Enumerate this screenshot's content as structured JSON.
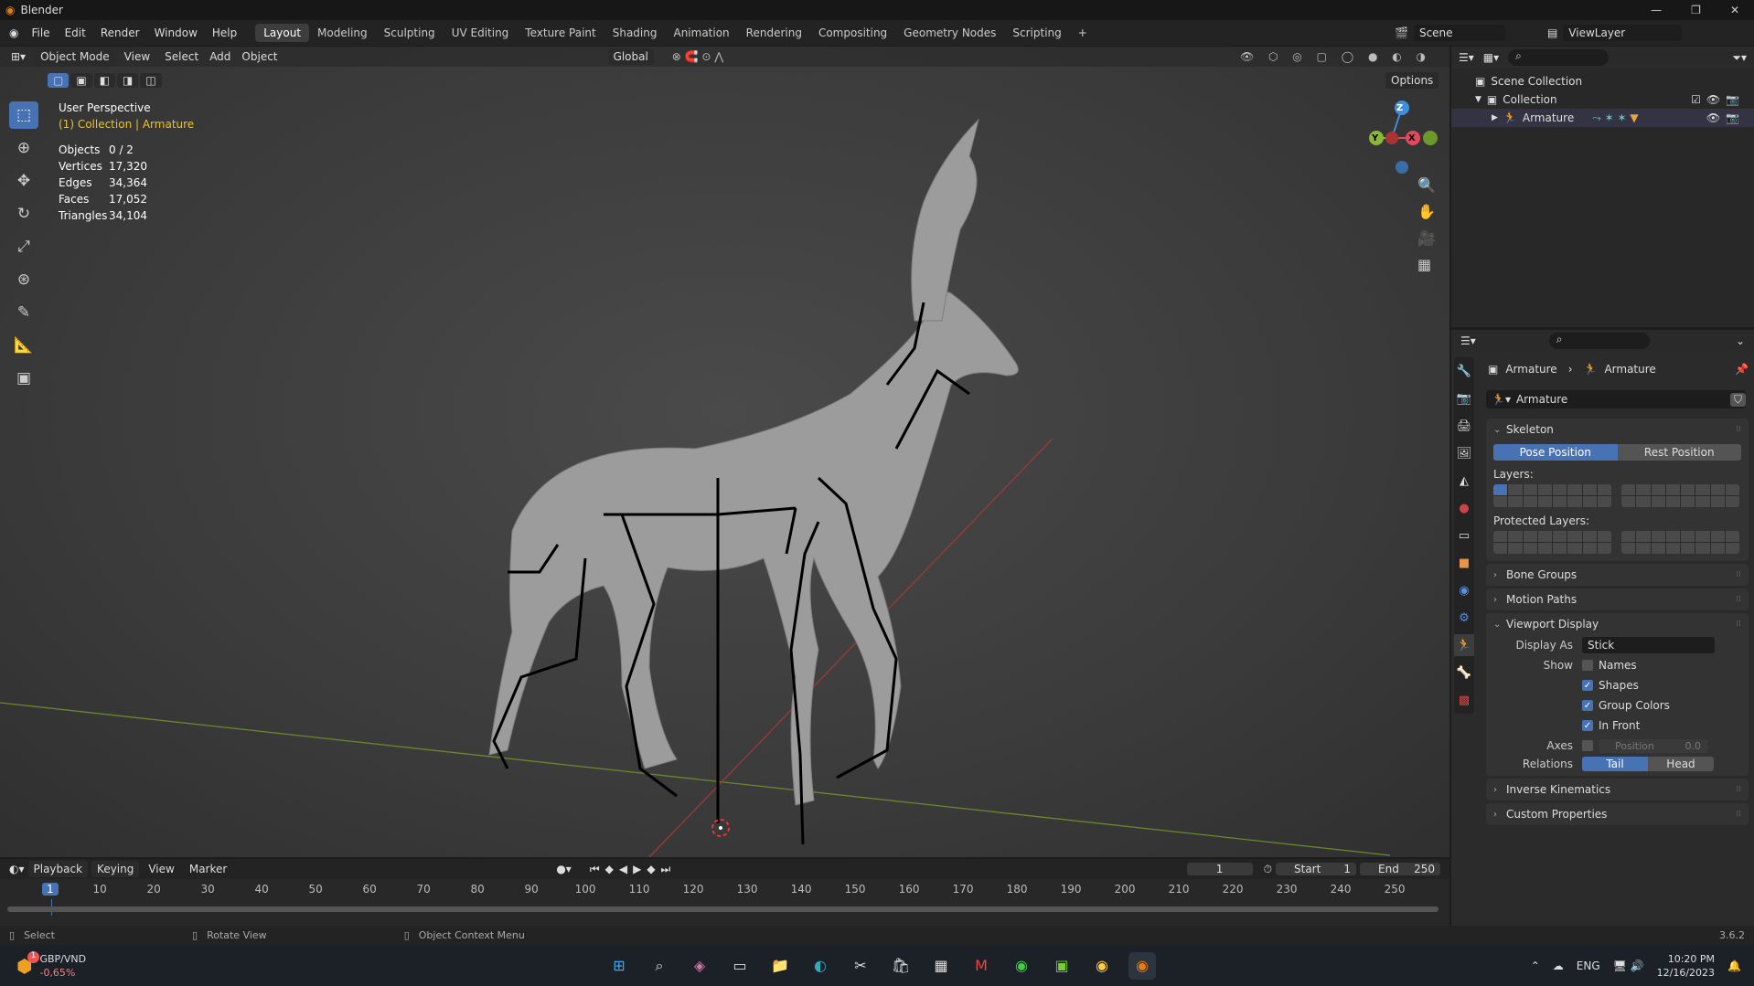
{
  "app": {
    "title": "Blender",
    "version": "3.6.2"
  },
  "menu": [
    "File",
    "Edit",
    "Render",
    "Window",
    "Help"
  ],
  "workspaces": [
    "Layout",
    "Modeling",
    "Sculpting",
    "UV Editing",
    "Texture Paint",
    "Shading",
    "Animation",
    "Rendering",
    "Compositing",
    "Geometry Nodes",
    "Scripting",
    "+"
  ],
  "scene": "Scene",
  "view_layer": "ViewLayer",
  "viewport": {
    "mode": "Object Mode",
    "menus": [
      "View",
      "Select",
      "Add",
      "Object"
    ],
    "orientation": "Global",
    "options": "Options",
    "overlay_title": "User Perspective",
    "overlay_sub": "(1) Collection | Armature",
    "stats": [
      {
        "k": "Objects",
        "v": "0 / 2"
      },
      {
        "k": "Vertices",
        "v": "17,320"
      },
      {
        "k": "Edges",
        "v": "34,364"
      },
      {
        "k": "Faces",
        "v": "17,052"
      },
      {
        "k": "Triangles",
        "v": "34,104"
      }
    ],
    "gizmo": {
      "z": "Z",
      "y": "Y",
      "x": "X"
    }
  },
  "outliner": {
    "scene_collection": "Scene Collection",
    "collection": "Collection",
    "armature": "Armature"
  },
  "properties": {
    "breadcrumb": [
      "Armature",
      "Armature"
    ],
    "data_name": "Armature",
    "skeleton": {
      "title": "Skeleton",
      "pose": "Pose Position",
      "rest": "Rest Position",
      "layers": "Layers:",
      "protected": "Protected Layers:"
    },
    "bone_groups": "Bone Groups",
    "motion_paths": "Motion Paths",
    "viewport_display": {
      "title": "Viewport Display",
      "display_as_label": "Display As",
      "display_as": "Stick",
      "show_label": "Show",
      "names": "Names",
      "names_on": false,
      "shapes": "Shapes",
      "shapes_on": true,
      "group_colors": "Group Colors",
      "group_colors_on": true,
      "in_front": "In Front",
      "in_front_on": true,
      "axes_label": "Axes",
      "axes_pos_label": "Position",
      "axes_pos": "0.0",
      "relations_label": "Relations",
      "tail": "Tail",
      "head": "Head"
    },
    "ik": "Inverse Kinematics",
    "custom": "Custom Properties"
  },
  "timeline": {
    "menus": [
      "Playback",
      "Keying",
      "View",
      "Marker"
    ],
    "current_frame": "1",
    "start_label": "Start",
    "start": "1",
    "end_label": "End",
    "end": "250",
    "ticks": [
      "10",
      "20",
      "30",
      "40",
      "50",
      "60",
      "70",
      "80",
      "90",
      "100",
      "110",
      "120",
      "130",
      "140",
      "150",
      "160",
      "170",
      "180",
      "190",
      "200",
      "210",
      "220",
      "230",
      "240",
      "250"
    ]
  },
  "status": {
    "select": "Select",
    "rotate": "Rotate View",
    "context": "Object Context Menu"
  },
  "taskbar": {
    "widget_title": "GBP/VND",
    "widget_value": "-0,65%",
    "badge": "1",
    "lang": "ENG",
    "time": "10:20 PM",
    "date": "12/16/2023"
  }
}
